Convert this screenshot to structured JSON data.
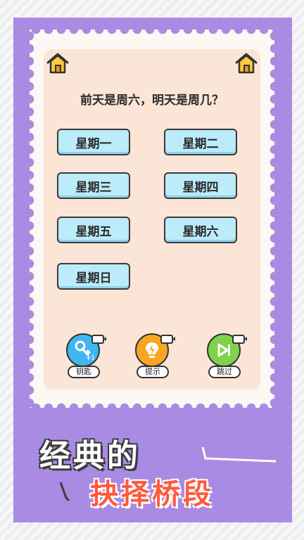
{
  "question": "前天是周六，明天是周几？",
  "options": [
    "星期一",
    "星期二",
    "星期三",
    "星期四",
    "星期五",
    "星期六",
    "星期日"
  ],
  "tools": [
    {
      "label": "钥匙",
      "icon": "key-icon",
      "badge": "+1",
      "color": "#3fb6f0"
    },
    {
      "label": "提示",
      "icon": "lightbulb-icon",
      "color": "#f6a623"
    },
    {
      "label": "跳过",
      "icon": "skip-icon",
      "color": "#7fd34a"
    }
  ],
  "slogan": {
    "line1": "经典的",
    "line2": "抉择桥段"
  },
  "colors": {
    "frame": "#a98be3",
    "panel": "#fbe5d6",
    "option": "#bcebfa",
    "accent": "#ff5a3c"
  }
}
